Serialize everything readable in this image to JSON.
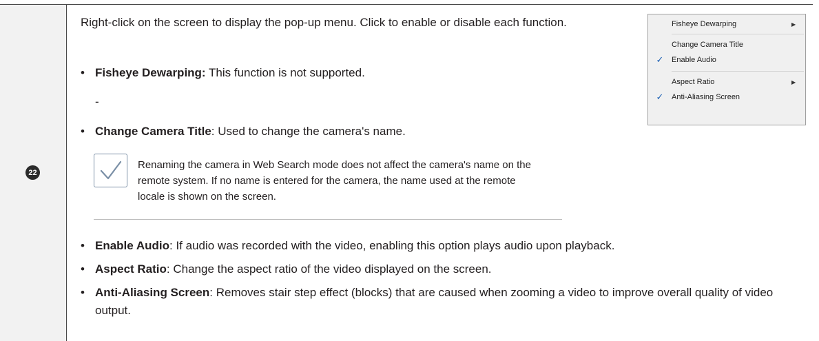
{
  "step_number": "22",
  "intro": "Right-click on the screen to display the pop-up menu. Click to enable or disable each function.",
  "bullet_symbol": "•",
  "dash": "-",
  "bullets": [
    {
      "term": "Fisheye Dewarping:",
      "desc": " This function is not supported."
    },
    {
      "term": "Change Camera Title",
      "desc": ": Used to change the camera's name."
    },
    {
      "term": "Enable Audio",
      "desc": ": If audio was recorded with the video, enabling this option plays audio upon playback."
    },
    {
      "term": "Aspect Ratio",
      "desc": ": Change the aspect ratio of the video displayed on the screen."
    },
    {
      "term": "Anti-Aliasing Screen",
      "desc": ": Removes stair step effect (blocks) that are caused when zooming a video to improve overall quality of video output."
    }
  ],
  "note": "Renaming the camera in Web Search mode does not affect the camera's name on the remote system. If no name is entered for the camera, the name used at the remote locale is shown on the screen.",
  "menu": {
    "items": [
      {
        "label": "Fisheye Dewarping",
        "checked": false,
        "submenu": true
      },
      {
        "label": "Change Camera Title",
        "checked": false,
        "submenu": false
      },
      {
        "label": "Enable Audio",
        "checked": true,
        "submenu": false
      },
      {
        "label": "Aspect Ratio",
        "checked": false,
        "submenu": true
      },
      {
        "label": "Anti-Aliasing Screen",
        "checked": true,
        "submenu": false
      }
    ],
    "check_glyph": "✓",
    "arrow_glyph": "▶"
  }
}
